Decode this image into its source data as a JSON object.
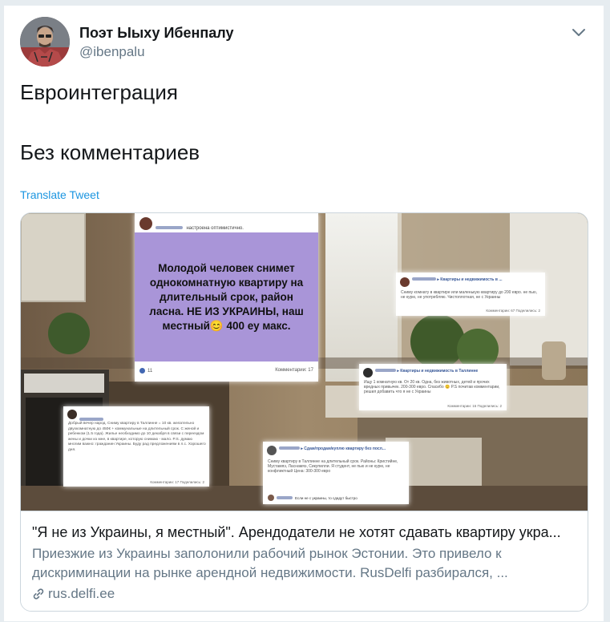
{
  "tweet": {
    "author_name": "Поэт Ыыху Ибенпалу",
    "author_handle": "@ibenpalu",
    "text_lines": [
      "Евроинтеграция",
      "Без комментариев"
    ],
    "translate_label": "Translate Tweet"
  },
  "card": {
    "title": "\"Я не из Украины, я местный\". Арендодатели не хотят сдавать квартиру укра...",
    "description": "Приезжие из Украины заполонили рабочий рынок Эстонии. Это привело к дискриминации на рынке арендной недвижимости. RusDelfi разбирался, ...",
    "domain": "rus.delfi.ee",
    "image": {
      "main_post": {
        "header_status": "настроена оптимистично.",
        "text": "Молодой человек снимет однокомнатную квартиру на длительный срок, район ласна. НЕ ИЗ УКРАИНЫ, наш местный😊 400 еу макс.",
        "likes": "11",
        "comments": "Комментарии: 17"
      },
      "post_top_right": {
        "group": "Квартиры и недвижимость в ...",
        "text": "Сниму комнату в квартире или маленькую квартиру до 200 евро. не пью, не курю, не употребляю. Чистоплотная, не с Украины",
        "footer": "Комментарии: 67 Поделились: 2"
      },
      "post_middle_right": {
        "group": "Квартиры и недвижимость в Таллинне",
        "text": "Ищу 1 комнатную кв. От 20 кв. Одна, без животных, детей и прочих вредных привычек. 200-300 евро. Спасибо 😊 P.S почитав комментарии, решил добавить что я не с Украины",
        "footer": "Комментарии: 16 Поделились: 2"
      },
      "post_left": {
        "text": "Добрый вечер народ. Сниму квартиру в Таллинне = 10 кв. желательно двухкомнатную до 450€ + коммунальные на длительный срок. С женой и ребенком (1.5 года). Жилье необходимо до 10 декабря в связи с переездом жены и дочки из мне, в квартире, которую снимаю - мало. P.S. думаю многим важно: гражданин Украины. Буду рад предложениям в л.с. Хорошего дня.",
        "footer": "Комментарии: 17 Поделились: 2"
      },
      "post_bottom": {
        "group": "Сдам/продам/куплю квартиру без посл...",
        "text": "Сниму квартиру в Таллинне на длительный срок. Районы: Кристийне, Мустамяэ, Ласнамяэ, Сикупилли. Я студент, не пью и не курю, не конфликтный Цена: 300-300 евро",
        "comment": "Если не с украины, то сдадут быстро"
      }
    }
  },
  "colors": {
    "link": "#1b95e0",
    "secondary_text": "#657786",
    "purple_box": "#a995d8"
  }
}
